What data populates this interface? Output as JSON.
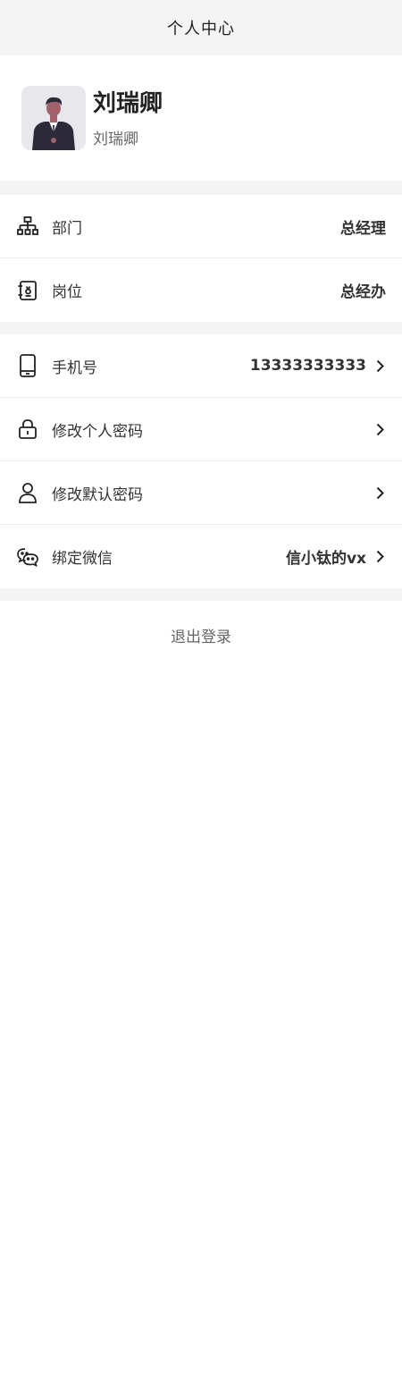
{
  "header": {
    "title": "个人中心"
  },
  "profile": {
    "name": "刘瑞卿",
    "subtitle": "刘瑞卿"
  },
  "org_section": {
    "items": [
      {
        "label": "部门",
        "value": "总经理",
        "icon": "org-chart-icon"
      },
      {
        "label": "岗位",
        "value": "总经办",
        "icon": "badge-icon"
      }
    ]
  },
  "account_section": {
    "items": [
      {
        "label": "手机号",
        "value": "13333333333",
        "icon": "phone-icon"
      },
      {
        "label": "修改个人密码",
        "value": "",
        "icon": "lock-icon"
      },
      {
        "label": "修改默认密码",
        "value": "",
        "icon": "user-icon"
      },
      {
        "label": "绑定微信",
        "value": "信小钛的vx",
        "icon": "wechat-icon"
      }
    ]
  },
  "footer": {
    "logout_label": "退出登录"
  },
  "colors": {
    "background": "#f4f4f4",
    "card": "#ffffff",
    "text": "#333333"
  }
}
